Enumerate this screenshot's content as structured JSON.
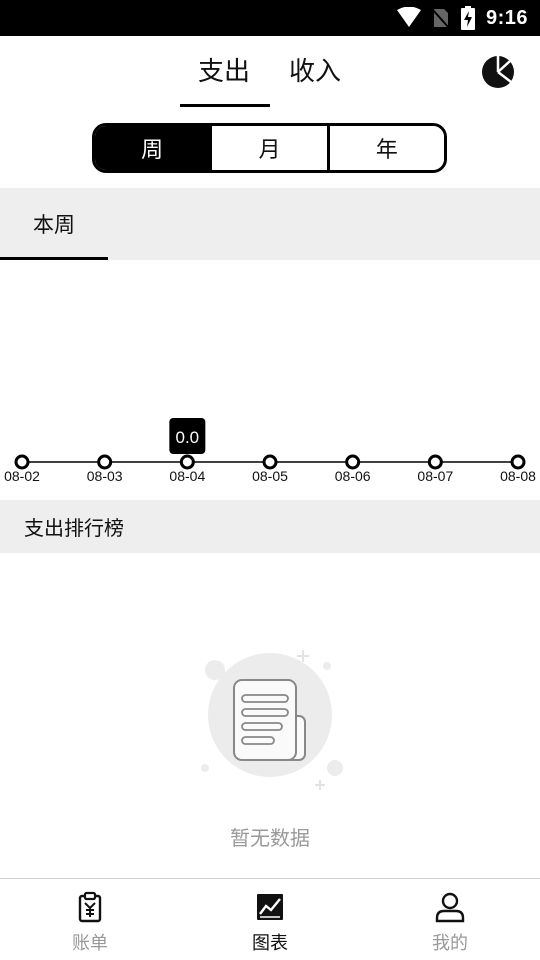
{
  "status_bar": {
    "time": "9:16"
  },
  "header": {
    "tabs": [
      {
        "label": "支出",
        "active": true
      },
      {
        "label": "收入",
        "active": false
      }
    ]
  },
  "segments": [
    {
      "label": "周",
      "active": true
    },
    {
      "label": "月",
      "active": false
    },
    {
      "label": "年",
      "active": false
    }
  ],
  "period_tab": {
    "label": "本周"
  },
  "chart_data": {
    "type": "line",
    "x": [
      "08-02",
      "08-03",
      "08-04",
      "08-05",
      "08-06",
      "08-07",
      "08-08"
    ],
    "values": [
      0,
      0,
      0,
      0,
      0,
      0,
      0
    ],
    "highlight": {
      "label": "0.0",
      "x": "08-04"
    }
  },
  "ranking": {
    "title": "支出排行榜",
    "empty_text": "暂无数据"
  },
  "bottom_nav": [
    {
      "label": "账单",
      "icon": "bill-icon",
      "active": false
    },
    {
      "label": "图表",
      "icon": "chart-icon",
      "active": true
    },
    {
      "label": "我的",
      "icon": "person-icon",
      "active": false
    }
  ],
  "colors": {
    "accent": "#000000",
    "inactive": "#999999",
    "strip": "#eeeeee"
  }
}
